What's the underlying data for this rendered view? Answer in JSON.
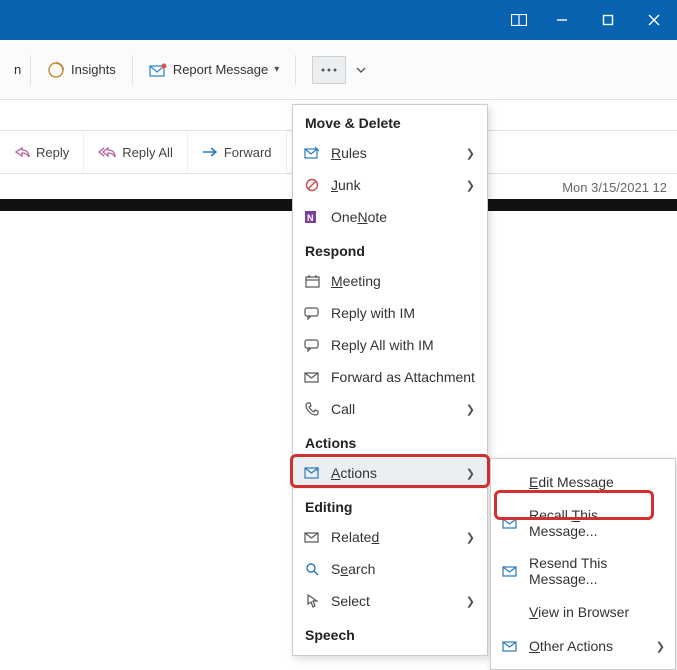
{
  "titlebar": {
    "minimize": "−",
    "maximize": "☐",
    "close": "✕"
  },
  "ribbon": {
    "item1_suffix": "n",
    "insights": "Insights",
    "report_message": "Report Message"
  },
  "msg": {
    "reply": "Reply",
    "reply_all": "Reply All",
    "forward": "Forward",
    "timestamp": "Mon 3/15/2021 12"
  },
  "menu": {
    "move_delete": "Move & Delete",
    "rules": "Rules",
    "junk": "Junk",
    "onenote": "OneNote",
    "respond": "Respond",
    "meeting": "Meeting",
    "reply_im": "Reply with IM",
    "reply_all_im": "Reply All with IM",
    "forward_attach": "Forward as Attachment",
    "call": "Call",
    "actions_header": "Actions",
    "actions": "Actions",
    "editing": "Editing",
    "related": "Related",
    "search": "Search",
    "select": "Select",
    "speech": "Speech"
  },
  "submenu": {
    "edit_message": "Edit Message",
    "recall": "Recall This Message...",
    "resend": "Resend This Message...",
    "view_browser": "View in Browser",
    "other_actions": "Other Actions"
  }
}
